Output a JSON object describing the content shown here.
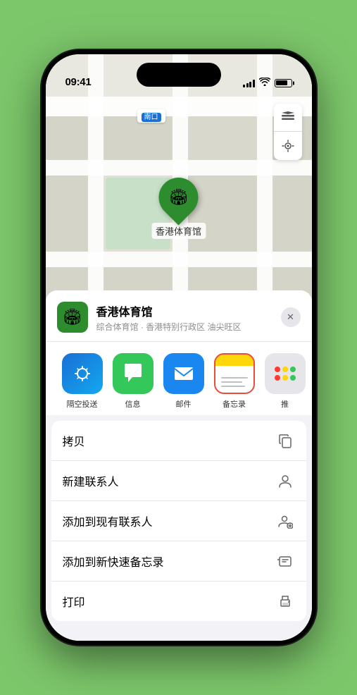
{
  "status_bar": {
    "time": "09:41",
    "location_arrow": "▲"
  },
  "map": {
    "nav_label": "南口",
    "map_btn_layers": "🗺",
    "map_btn_location": "◎"
  },
  "pin": {
    "label": "香港体育馆"
  },
  "location_header": {
    "name": "香港体育馆",
    "subtitle": "综合体育馆 · 香港特别行政区 油尖旺区",
    "close_label": "✕"
  },
  "apps": [
    {
      "id": "airdrop",
      "label": "隔空投送",
      "icon_type": "airdrop"
    },
    {
      "id": "messages",
      "label": "信息",
      "icon_type": "messages"
    },
    {
      "id": "mail",
      "label": "邮件",
      "icon_type": "mail"
    },
    {
      "id": "notes",
      "label": "备忘录",
      "icon_type": "notes",
      "selected": true
    },
    {
      "id": "more",
      "label": "推",
      "icon_type": "more"
    }
  ],
  "actions": [
    {
      "id": "copy",
      "label": "拷贝",
      "icon": "⎘"
    },
    {
      "id": "new-contact",
      "label": "新建联系人",
      "icon": "👤"
    },
    {
      "id": "add-contact",
      "label": "添加到现有联系人",
      "icon": "👤"
    },
    {
      "id": "add-note",
      "label": "添加到新快速备忘录",
      "icon": "📋"
    },
    {
      "id": "print",
      "label": "打印",
      "icon": "🖨"
    }
  ]
}
